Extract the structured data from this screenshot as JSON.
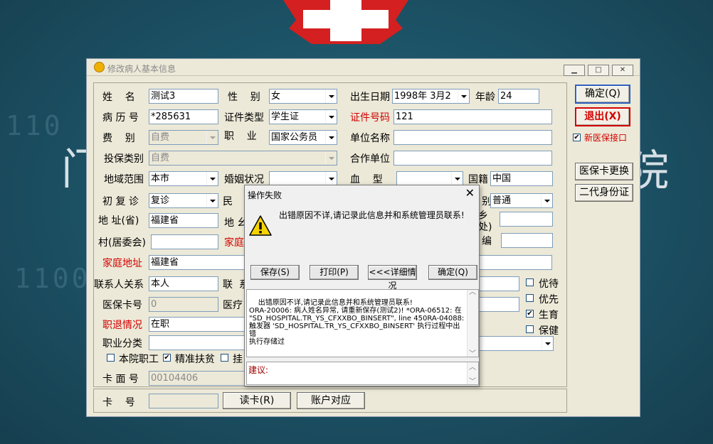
{
  "colors": {
    "accent": "#d40000",
    "link_blue": "#3060c0",
    "window": "#ece9d8"
  },
  "background": {
    "char_left": "门",
    "char_right": "院",
    "digits_1": "110",
    "digits_2": "11000"
  },
  "window": {
    "title": "修改病人基本信息",
    "min_icon": "minimize-icon",
    "max_icon": "maximize-icon",
    "close_icon": "close-icon"
  },
  "form": {
    "name_label": "姓    名",
    "name": "测试3",
    "gender_label": "性    别",
    "gender": "女",
    "birth_label": "出生日期",
    "birth": "1998年 3月2",
    "age_label": "年龄",
    "age": "24",
    "record_label": "病 历 号",
    "record": "*285631",
    "idtype_label": "证件类型",
    "idtype": "学生证",
    "idno_label": "证件号码",
    "idno": "121",
    "fee_label": "费    别",
    "fee": "自费",
    "job_label": "职    业",
    "job": "国家公务员",
    "company_label": "单位名称",
    "company": "",
    "ins_label": "投保类别",
    "ins": "自费",
    "coop_label": "合作单位",
    "coop": "",
    "area_label": "地域范围",
    "area": "本市",
    "marital_label": "婚姻状况",
    "marital": "",
    "blood_label": "血    型",
    "blood": "",
    "nation_label": "国籍",
    "nation": "中国",
    "visit_label": "初 复 诊",
    "visit": "复诊",
    "ethnic_label": "民",
    "category_label_tail": "别",
    "category": "普通",
    "addr_label": "地 址(省)",
    "addr": "福建省",
    "addr2_label": "地 幺",
    "township_label_a": "乡",
    "township_label_b": "处)",
    "village_label": "村(居委会)",
    "family_label_head": "家庭",
    "zip_label_tail": "编",
    "home_label": "家庭地址",
    "home": "福建省",
    "relation_label": "联系人关系",
    "relation": "本人",
    "contact_label": "联  系",
    "card_label": "医保卡号",
    "card": "0",
    "medical_label": "医疗",
    "retire_label": "职退情况",
    "retire": "在职",
    "jobcat_label": "职业分类",
    "chk_staff": "本院职工",
    "chk_poverty": "精准扶贫",
    "chk_hang": "挂",
    "cardface_label": "卡 面 号",
    "cardface": "00104406",
    "opt_priority": "优待",
    "opt_first": "优先",
    "opt_birth": "生育",
    "opt_health": "保健"
  },
  "side": {
    "ok": "确定(Q)",
    "exit": "退出(X)",
    "new_interface": "新医保接口",
    "card_change": "医保卡更换",
    "second_id": "二代身份证"
  },
  "bottom": {
    "card_label": "卡    号",
    "read_card": "读卡(R)",
    "account": "账户对应"
  },
  "dialog": {
    "title": "操作失败",
    "message": "出错原因不详,请记录此信息并和系统管理员联系!",
    "save": "保存(S)",
    "print": "打印(P)",
    "detail": "<<<详细情况",
    "ok": "确定(Q)",
    "detail_text": "出错原因不详,请记录此信息并和系统管理员联系!\nORA-20006: 病人姓名异常, 请重新保存(测试2)! *ORA-06512: 在 \"SD_HOSPITAL.TR_YS_CFXXBO_BINSERT\", line 450RA-04088: 触发器 'SD_HOSPITAL.TR_YS_CFXXBO_BINSERT' 执行过程中出错\n执行存储过",
    "suggest_label": "建议:"
  }
}
